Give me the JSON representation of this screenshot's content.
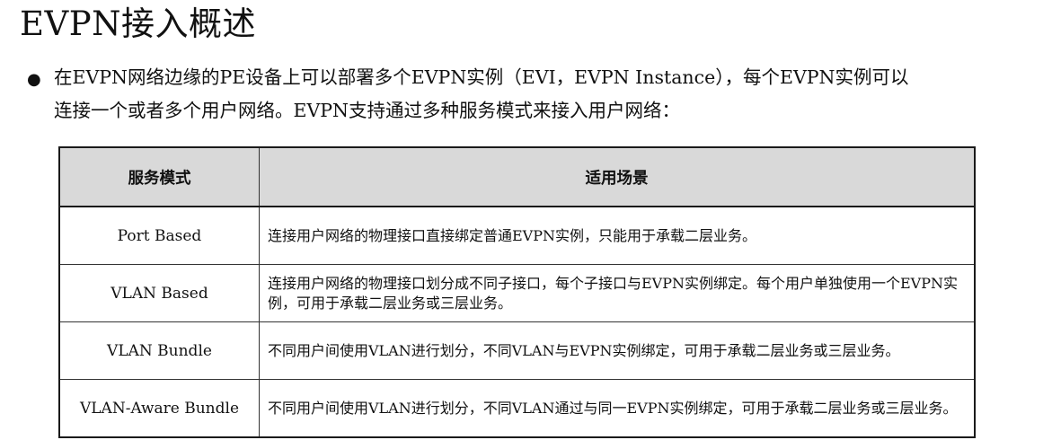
{
  "title": "EVPN接入概述",
  "bullet": {
    "line1": "在EVPN网络边缘的PE设备上可以部署多个EVPN实例（EVI，EVPN Instance），每个EVPN实例可以",
    "line2": "连接一个或者多个用户网络。EVPN支持通过多种服务模式来接入用户网络："
  },
  "table": {
    "headers": [
      "服务模式",
      "适用场景"
    ],
    "rows": [
      {
        "mode": "Port Based",
        "scene": "连接用户网络的物理接口直接绑定普通EVPN实例，只能用于承载二层业务。"
      },
      {
        "mode": "VLAN Based",
        "scene": "连接用户网络的物理接口划分成不同子接口，每个子接口与EVPN实例绑定。每个用户单独使用一个EVPN实例，可用于承载二层业务或三层业务。"
      },
      {
        "mode": "VLAN Bundle",
        "scene": "不同用户间使用VLAN进行划分，不同VLAN与EVPN实例绑定，可用于承载二层业务或三层业务。"
      },
      {
        "mode": "VLAN-Aware Bundle",
        "scene": "不同用户间使用VLAN进行划分，不同VLAN通过与同一EVPN实例绑定，可用于承载二层业务或三层业务。"
      }
    ]
  }
}
